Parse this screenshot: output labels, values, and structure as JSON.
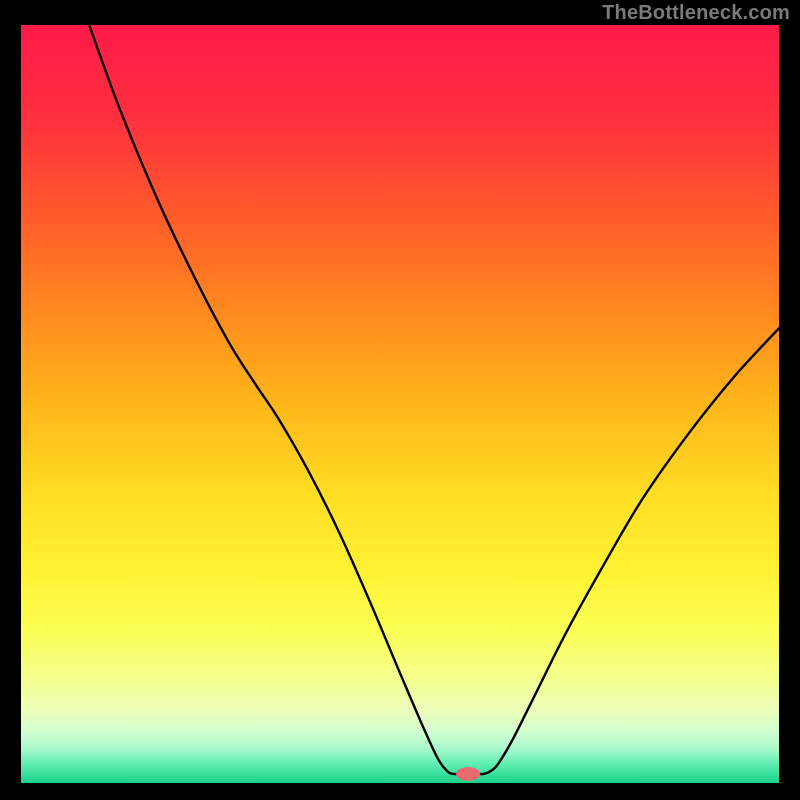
{
  "watermark": "TheBottleneck.com",
  "chart_data": {
    "type": "line",
    "title": "",
    "xlabel": "",
    "ylabel": "",
    "xlim": [
      0,
      100
    ],
    "ylim": [
      0,
      100
    ],
    "gradient_stops": [
      {
        "offset": 0.0,
        "color": "#ff1a48"
      },
      {
        "offset": 0.12,
        "color": "#ff2f3f"
      },
      {
        "offset": 0.25,
        "color": "#ff5a2a"
      },
      {
        "offset": 0.38,
        "color": "#ff8a1f"
      },
      {
        "offset": 0.5,
        "color": "#ffb61a"
      },
      {
        "offset": 0.62,
        "color": "#ffde23"
      },
      {
        "offset": 0.72,
        "color": "#fff133"
      },
      {
        "offset": 0.8,
        "color": "#fbff55"
      },
      {
        "offset": 0.86,
        "color": "#f4ff8c"
      },
      {
        "offset": 0.905,
        "color": "#ecffbb"
      },
      {
        "offset": 0.935,
        "color": "#cfffd0"
      },
      {
        "offset": 0.955,
        "color": "#a8f9cc"
      },
      {
        "offset": 0.975,
        "color": "#60efb2"
      },
      {
        "offset": 1.0,
        "color": "#17d18a"
      }
    ],
    "series": [
      {
        "name": "bottleneck-curve",
        "points": [
          {
            "x": 9.0,
            "y": 100.0
          },
          {
            "x": 13.0,
            "y": 89.0
          },
          {
            "x": 18.0,
            "y": 77.0
          },
          {
            "x": 23.0,
            "y": 66.5
          },
          {
            "x": 27.5,
            "y": 58.0
          },
          {
            "x": 31.0,
            "y": 52.5
          },
          {
            "x": 34.0,
            "y": 48.0
          },
          {
            "x": 38.0,
            "y": 41.0
          },
          {
            "x": 42.0,
            "y": 33.0
          },
          {
            "x": 46.0,
            "y": 24.0
          },
          {
            "x": 50.0,
            "y": 14.5
          },
          {
            "x": 53.0,
            "y": 7.5
          },
          {
            "x": 55.0,
            "y": 3.2
          },
          {
            "x": 56.2,
            "y": 1.6
          },
          {
            "x": 57.0,
            "y": 1.2
          },
          {
            "x": 58.5,
            "y": 1.2
          },
          {
            "x": 60.0,
            "y": 1.2
          },
          {
            "x": 61.0,
            "y": 1.2
          },
          {
            "x": 62.0,
            "y": 1.6
          },
          {
            "x": 63.0,
            "y": 2.6
          },
          {
            "x": 65.0,
            "y": 6.0
          },
          {
            "x": 68.0,
            "y": 12.0
          },
          {
            "x": 72.0,
            "y": 20.0
          },
          {
            "x": 77.0,
            "y": 29.0
          },
          {
            "x": 82.0,
            "y": 37.5
          },
          {
            "x": 88.0,
            "y": 46.0
          },
          {
            "x": 94.0,
            "y": 53.5
          },
          {
            "x": 100.0,
            "y": 60.0
          }
        ]
      }
    ],
    "marker": {
      "x": 59.0,
      "y": 1.2,
      "color": "#e86a6f",
      "rx": 1.6,
      "ry": 0.9
    }
  }
}
